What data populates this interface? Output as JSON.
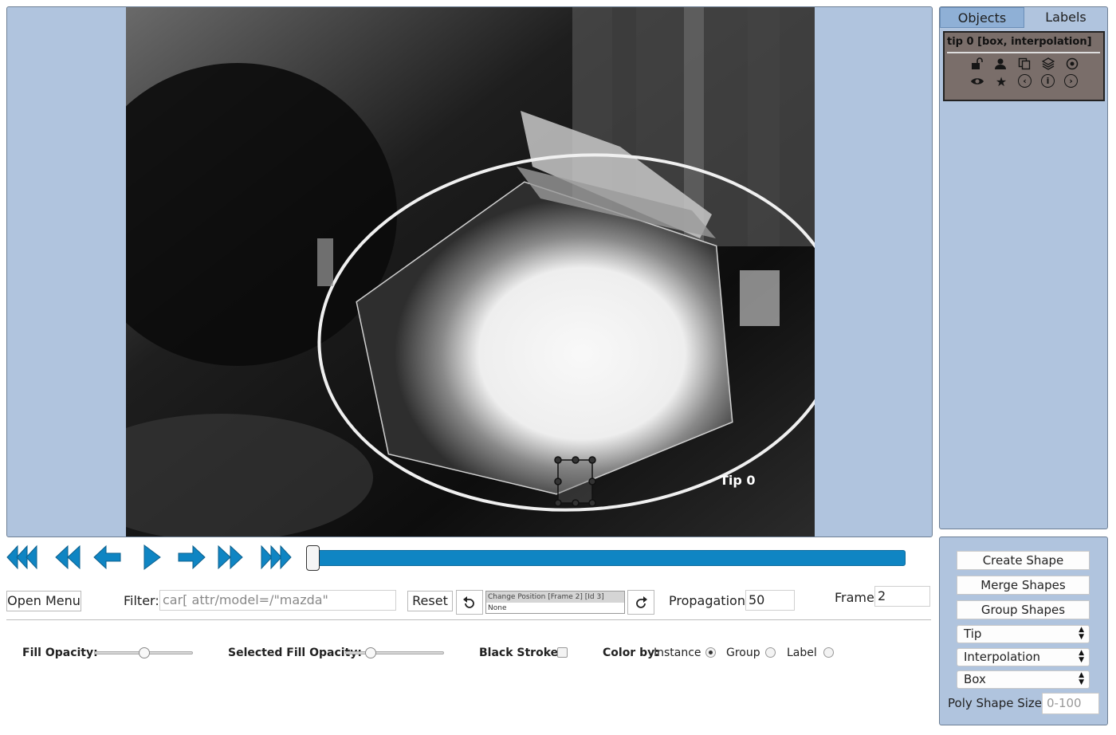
{
  "sidebar": {
    "tabs": [
      {
        "label": "Objects",
        "active": true
      },
      {
        "label": "Labels",
        "active": false
      }
    ],
    "object": {
      "title": "tip 0 [box, interpolation]",
      "icons_row1": [
        "unlock-icon",
        "user-icon",
        "copy-icon",
        "layers-icon",
        "target-icon"
      ],
      "icons_row2": [
        "eye-icon",
        "star-icon",
        "previous-icon",
        "info-icon",
        "next-icon"
      ]
    }
  },
  "canvas": {
    "shape_label": "Tip 0"
  },
  "controls": {
    "create_shape": "Create Shape",
    "merge_shapes": "Merge Shapes",
    "group_shapes": "Group Shapes",
    "label_select": "Tip",
    "mode_select": "Interpolation",
    "shape_select": "Box",
    "poly_label": "Poly Shape Size:",
    "poly_placeholder": "0-100"
  },
  "player": {
    "buttons": [
      "first-frame-icon",
      "backward-icon",
      "previous-frame-icon",
      "play-icon",
      "next-frame-icon",
      "forward-icon",
      "last-frame-icon"
    ],
    "progress_position": 0
  },
  "toolbar": {
    "open_menu": "Open Menu",
    "filter_label": "Filter:",
    "filter_value": "car[ attr/model=/\"mazda\"",
    "reset": "Reset",
    "history_top": "Change Position [Frame 2] [Id 3]",
    "history_bottom": "None",
    "propagation_label": "Propagation:",
    "propagation_value": "50",
    "frame_label": "Frame",
    "frame_value": "2"
  },
  "settings": {
    "fill_opacity": "Fill Opacity:",
    "fill_opacity_value": 0.5,
    "selected_fill_opacity": "Selected Fill Opacity:",
    "selected_fill_opacity_value": 0.22,
    "black_stroke": "Black Stroke:",
    "color_by": "Color by:",
    "color_options": [
      "Instance",
      "Group",
      "Label"
    ],
    "color_selected": "Instance"
  },
  "colors": {
    "panel_bg": "#b0c4de",
    "accent": "#0f85c3"
  }
}
